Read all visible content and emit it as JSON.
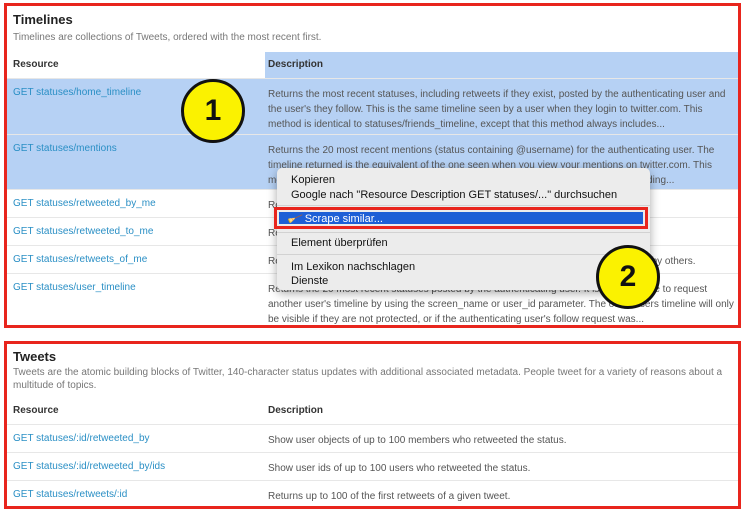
{
  "timelines": {
    "title": "Timelines",
    "description": "Timelines are collections of Tweets, ordered with the most recent first.",
    "col_resource": "Resource",
    "col_description": "Description",
    "rows": [
      {
        "resource": "GET statuses/home_timeline",
        "description": "Returns the most recent statuses, including retweets if they exist, posted by the authenticating user and the user's they follow. This is the same timeline seen by a user when they login to twitter.com. This method is identical to statuses/friends_timeline, except that this method always includes..."
      },
      {
        "resource": "GET statuses/mentions",
        "description": "Returns the 20 most recent mentions (status containing @username) for the authenticating user. The timeline returned is the equivalent of the one seen when you view your mentions on twitter.com. This method can only return up to 800 statuses. If include_rts is set only 800 statuses including..."
      },
      {
        "resource": "GET statuses/retweeted_by_me",
        "description": "Returns the 20 most recent retweets posted by the authenticating user."
      },
      {
        "resource": "GET statuses/retweeted_to_me",
        "description": "Returns the 20 most recent retweets posted by users the authenticating user follow."
      },
      {
        "resource": "GET statuses/retweets_of_me",
        "description": "Returns the 20 most recent tweets of the authenticated user that have been retweeted by others."
      },
      {
        "resource": "GET statuses/user_timeline",
        "description": "Returns the 20 most recent statuses posted by the authenticating user. It is also possible to request another user's timeline by using the screen_name or user_id parameter. The other users timeline will only be visible if they are not protected, or if the authenticating user's follow request was..."
      }
    ]
  },
  "tweets": {
    "title": "Tweets",
    "description": "Tweets are the atomic building blocks of Twitter, 140-character status updates with additional associated metadata. People tweet for a variety of reasons about a multitude of topics.",
    "col_resource": "Resource",
    "col_description": "Description",
    "rows": [
      {
        "resource": "GET statuses/:id/retweeted_by",
        "description": "Show user objects of up to 100 members who retweeted the status."
      },
      {
        "resource": "GET statuses/:id/retweeted_by/ids",
        "description": "Show user ids of up to 100 users who retweeted the status."
      },
      {
        "resource": "GET statuses/retweets/:id",
        "description": "Returns up to 100 of the first retweets of a given tweet."
      }
    ]
  },
  "context_menu": {
    "items": [
      "Kopieren",
      "Google nach \"Resource  Description GET statuses/...\" durchsuchen",
      "Scrape similar...",
      "Element überprüfen",
      "Im Lexikon nachschlagen",
      "Dienste"
    ],
    "highlighted_index": 2,
    "scrape_icon": "broom-icon"
  },
  "badges": [
    "1",
    "2"
  ],
  "colors": {
    "highlight_border": "#e8251d",
    "selection": "#b6d1f4",
    "menu_highlight": "#1d5fd6",
    "link": "#2a8fc5",
    "badge": "#fbf200"
  }
}
